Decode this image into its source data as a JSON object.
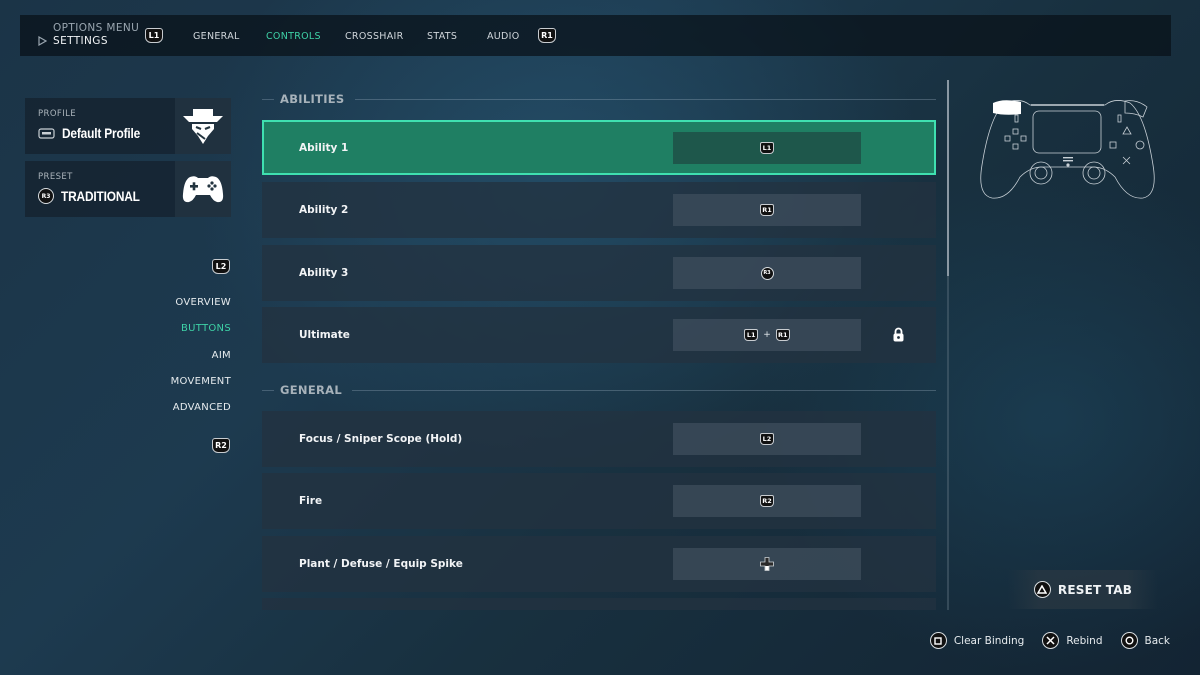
{
  "header": {
    "breadcrumb_parent": "OPTIONS MENU",
    "breadcrumb_current": "SETTINGS",
    "prev_tab_button": "L1",
    "next_tab_button": "R1",
    "tabs": [
      {
        "label": "GENERAL",
        "active": false
      },
      {
        "label": "CONTROLS",
        "active": true
      },
      {
        "label": "CROSSHAIR",
        "active": false
      },
      {
        "label": "STATS",
        "active": false
      },
      {
        "label": "AUDIO",
        "active": false
      }
    ]
  },
  "profile": {
    "label": "PROFILE",
    "value": "Default Profile",
    "icon": "agent-hat-icon"
  },
  "preset": {
    "label": "PRESET",
    "button": "R3",
    "value": "TRADITIONAL",
    "icon": "gamepad-icon"
  },
  "sidenav": {
    "prev_button": "L2",
    "next_button": "R2",
    "items": [
      {
        "label": "OVERVIEW",
        "active": false
      },
      {
        "label": "BUTTONS",
        "active": true
      },
      {
        "label": "AIM",
        "active": false
      },
      {
        "label": "MOVEMENT",
        "active": false
      },
      {
        "label": "ADVANCED",
        "active": false
      }
    ]
  },
  "sections": [
    {
      "title": "ABILITIES",
      "rows": [
        {
          "name": "Ability 1",
          "binding": [
            "L1"
          ],
          "selected": true,
          "locked": false
        },
        {
          "name": "Ability 2",
          "binding": [
            "R1"
          ],
          "selected": false,
          "locked": false
        },
        {
          "name": "Ability 3",
          "binding": [
            "R3"
          ],
          "selected": false,
          "locked": false
        },
        {
          "name": "Ultimate",
          "binding": [
            "L1",
            "+",
            "R1"
          ],
          "selected": false,
          "locked": true
        }
      ]
    },
    {
      "title": "GENERAL",
      "rows": [
        {
          "name": "Focus / Sniper Scope (Hold)",
          "binding": [
            "L2"
          ],
          "selected": false,
          "locked": false
        },
        {
          "name": "Fire",
          "binding": [
            "R2"
          ],
          "selected": false,
          "locked": false
        },
        {
          "name": "Plant / Defuse / Equip Spike",
          "binding": [
            "DPAD-DOWN"
          ],
          "selected": false,
          "locked": false
        }
      ]
    }
  ],
  "scroll": {
    "position_fraction": 0.0,
    "visible_fraction": 0.37
  },
  "reset_tab": {
    "label": "RESET TAB",
    "button": "triangle"
  },
  "footer": [
    {
      "label": "Clear Binding",
      "button": "square"
    },
    {
      "label": "Rebind",
      "button": "cross"
    },
    {
      "label": "Back",
      "button": "circle"
    }
  ],
  "colors": {
    "accent": "#3ed1a6",
    "selected_row": "#1f7f63",
    "selected_outline": "#3fe0b0"
  }
}
